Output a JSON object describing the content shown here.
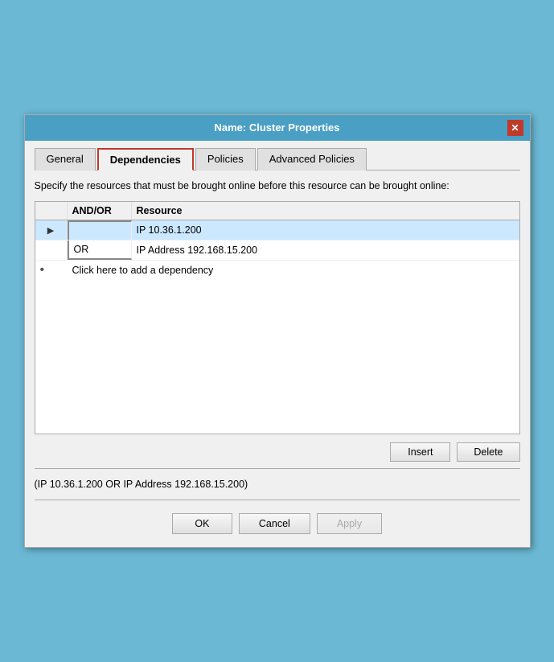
{
  "dialog": {
    "title": "Name: Cluster Properties",
    "close_label": "✕"
  },
  "tabs": {
    "items": [
      {
        "label": "General",
        "active": false
      },
      {
        "label": "Dependencies",
        "active": true
      },
      {
        "label": "Policies",
        "active": false
      },
      {
        "label": "Advanced Policies",
        "active": false
      }
    ]
  },
  "content": {
    "description": "Specify the resources that must be brought online before this resource can be brought online:",
    "table": {
      "headers": [
        "",
        "AND/OR",
        "Resource"
      ],
      "rows": [
        {
          "indicator": "▶",
          "and_or": "",
          "resource": "IP 10.36.1.200",
          "selected": true
        },
        {
          "indicator": "",
          "and_or": "OR",
          "resource": "IP Address 192.168.15.200",
          "selected": false
        }
      ],
      "add_row": {
        "bullet": "•",
        "label": "Click here to add a dependency"
      }
    },
    "buttons": {
      "insert": "Insert",
      "delete": "Delete"
    },
    "expression": "(IP 10.36.1.200  OR IP Address 192.168.15.200)"
  },
  "footer": {
    "ok": "OK",
    "cancel": "Cancel",
    "apply": "Apply"
  }
}
